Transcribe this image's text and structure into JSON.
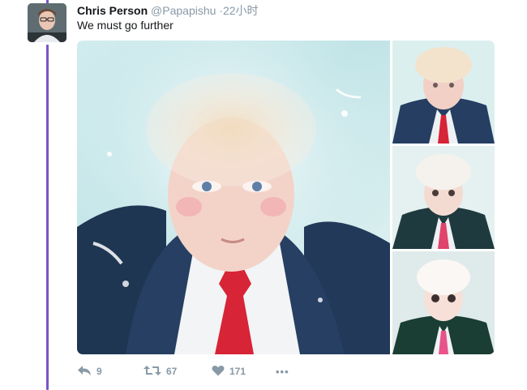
{
  "tweet": {
    "author_name": "Chris Person",
    "handle": "@Papapishu",
    "separator": "·",
    "time": "22小时",
    "text": "We must go further"
  },
  "actions": {
    "reply_count": "9",
    "retweet_count": "67",
    "like_count": "171",
    "more_label": "•••"
  },
  "icons": {
    "reply": "reply-icon",
    "retweet": "retweet-icon",
    "like": "heart-icon",
    "more": "more-dots-icon"
  },
  "colors": {
    "thread_line": "#7a55c7",
    "meta_text": "#8899a6",
    "text": "#14171a"
  }
}
